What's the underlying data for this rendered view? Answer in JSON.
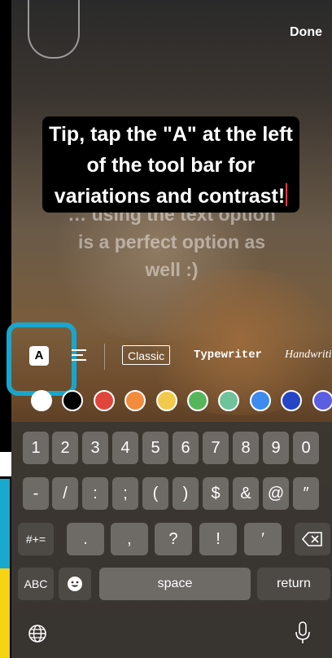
{
  "header": {
    "done_label": "Done"
  },
  "caption": {
    "text": "Tip, tap the \"A\" at the left of the tool bar for variations and contrast!"
  },
  "background_caption": {
    "text": "… using the text option is a perfect option as well :)"
  },
  "toolbar": {
    "font_toggle_label": "A",
    "styles": [
      "Classic",
      "Typewriter",
      "Handwriting"
    ]
  },
  "colors": [
    "#ffffff",
    "#000000",
    "#e0453b",
    "#f28b3c",
    "#f2c94c",
    "#57b65c",
    "#6ec39a",
    "#3d8bef",
    "#2545c7",
    "#5b5ee0"
  ],
  "keyboard": {
    "row1": [
      "1",
      "2",
      "3",
      "4",
      "5",
      "6",
      "7",
      "8",
      "9",
      "0"
    ],
    "row2": [
      "-",
      "/",
      ":",
      ";",
      "(",
      ")",
      "$",
      "&",
      "@",
      "″"
    ],
    "row3": [
      ".",
      ",",
      "?",
      "!",
      "′"
    ],
    "symbols_key": "#+=",
    "abc_key": "ABC",
    "space_key": "space",
    "return_key": "return"
  },
  "icons": [
    "delete-icon",
    "emoji-icon",
    "globe-icon",
    "microphone-icon",
    "align-text-icon"
  ]
}
